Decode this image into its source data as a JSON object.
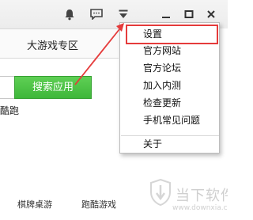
{
  "nav": {
    "zone_label": "大游戏专区"
  },
  "search": {
    "input_value": "",
    "button_label": "搜索应用",
    "hint": "酷跑"
  },
  "bottom_links": [
    "棋牌桌游",
    "跑酷游戏"
  ],
  "menu": {
    "items": [
      "设置",
      "官方网站",
      "官方论坛",
      "加入内测",
      "检查更新",
      "手机常见问题"
    ],
    "footer_item": "关于"
  },
  "watermark": {
    "name": "当下软件园",
    "url": "www.downxia.com"
  },
  "icons": [
    "bell-icon",
    "feedback-icon",
    "menu-dropdown-icon",
    "minimize-icon",
    "maximize-icon",
    "close-icon"
  ],
  "colors": {
    "accent_green": "#3eb73a",
    "annotation_red": "#e53b3b"
  }
}
